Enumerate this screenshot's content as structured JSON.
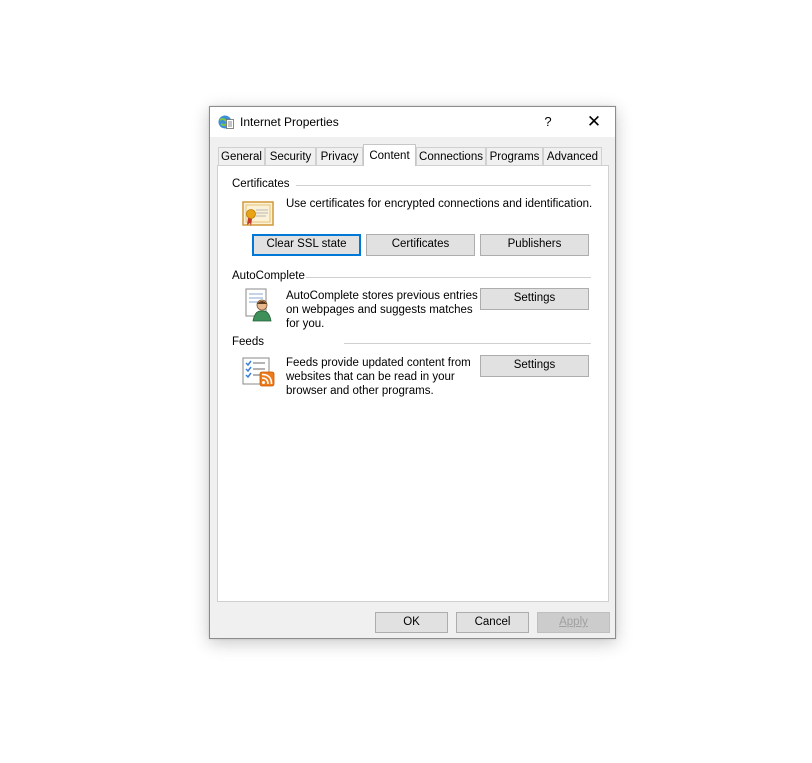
{
  "window": {
    "title": "Internet Properties",
    "help_label": "?",
    "close_label": "✕",
    "icon": "internet-options-icon"
  },
  "tabs": [
    {
      "label": "General",
      "active": false
    },
    {
      "label": "Security",
      "active": false
    },
    {
      "label": "Privacy",
      "active": false
    },
    {
      "label": "Content",
      "active": true
    },
    {
      "label": "Connections",
      "active": false
    },
    {
      "label": "Programs",
      "active": false
    },
    {
      "label": "Advanced",
      "active": false
    }
  ],
  "certificates": {
    "heading": "Certificates",
    "description": "Use certificates for encrypted connections and identification.",
    "icon": "certificate-icon",
    "buttons": {
      "clear_ssl": "Clear SSL state",
      "certificates": "Certificates",
      "publishers": "Publishers"
    }
  },
  "autocomplete": {
    "heading": "AutoComplete",
    "description_lines": [
      "AutoComplete stores previous entries",
      "on webpages and suggests matches",
      "for you."
    ],
    "icon": "autocomplete-user-icon",
    "settings_label": "Settings"
  },
  "feeds": {
    "heading": "Feeds",
    "description_lines": [
      "Feeds provide updated content from",
      "websites that can be read in your",
      "browser and other programs."
    ],
    "icon": "feed-list-icon",
    "settings_label": "Settings"
  },
  "footer": {
    "ok": "OK",
    "cancel": "Cancel",
    "apply": "Apply"
  },
  "colors": {
    "focus_border": "#0078d7",
    "feed_orange": "#f07a1a"
  }
}
